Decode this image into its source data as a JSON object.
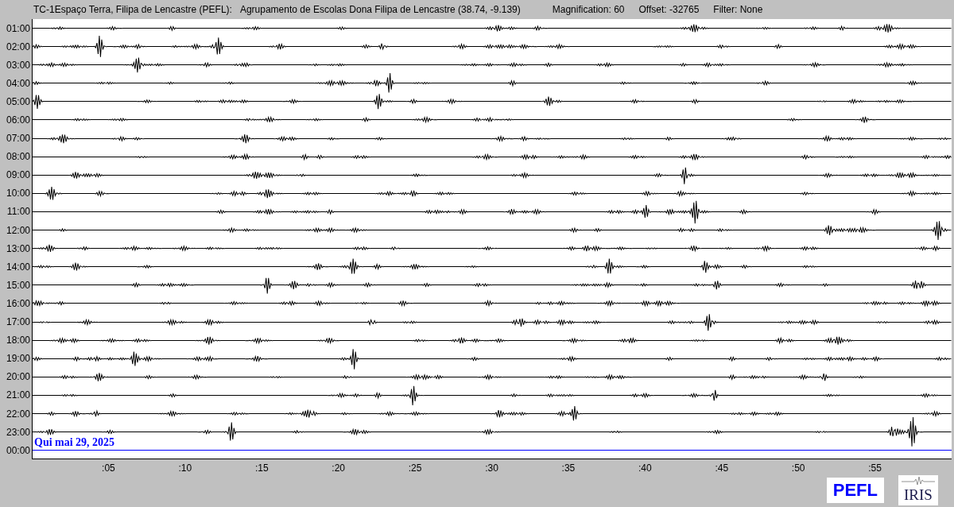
{
  "header": {
    "station": "TC-1Espaço Terra, Filipa de Lencastre (PEFL):",
    "location": "Agrupamento de Escolas Dona Filipa de Lencastre (38.74, -9.139)",
    "magnification": "Magnification: 60",
    "offset": "Offset: -32765",
    "filter": "Filter: None"
  },
  "rows": [
    {
      "label": "01:00",
      "kind": "trace"
    },
    {
      "label": "02:00",
      "kind": "trace"
    },
    {
      "label": "03:00",
      "kind": "trace"
    },
    {
      "label": "04:00",
      "kind": "trace"
    },
    {
      "label": "05:00",
      "kind": "trace"
    },
    {
      "label": "06:00",
      "kind": "trace"
    },
    {
      "label": "07:00",
      "kind": "trace"
    },
    {
      "label": "08:00",
      "kind": "trace"
    },
    {
      "label": "09:00",
      "kind": "trace"
    },
    {
      "label": "10:00",
      "kind": "trace"
    },
    {
      "label": "11:00",
      "kind": "trace"
    },
    {
      "label": "12:00",
      "kind": "trace"
    },
    {
      "label": "13:00",
      "kind": "trace"
    },
    {
      "label": "14:00",
      "kind": "trace"
    },
    {
      "label": "15:00",
      "kind": "trace"
    },
    {
      "label": "16:00",
      "kind": "trace"
    },
    {
      "label": "17:00",
      "kind": "trace"
    },
    {
      "label": "18:00",
      "kind": "trace"
    },
    {
      "label": "19:00",
      "kind": "trace"
    },
    {
      "label": "20:00",
      "kind": "trace"
    },
    {
      "label": "21:00",
      "kind": "trace"
    },
    {
      "label": "22:00",
      "kind": "trace"
    },
    {
      "label": "23:00",
      "kind": "trace"
    },
    {
      "label": "00:00",
      "kind": "current"
    }
  ],
  "date_label": "Qui mai 29, 2025",
  "x_axis": [
    ":05",
    ":10",
    ":15",
    ":20",
    ":25",
    ":30",
    ":35",
    ":40",
    ":45",
    ":50",
    ":55"
  ],
  "logos": {
    "pefl": "PEFL",
    "iris": "IRIS"
  }
}
